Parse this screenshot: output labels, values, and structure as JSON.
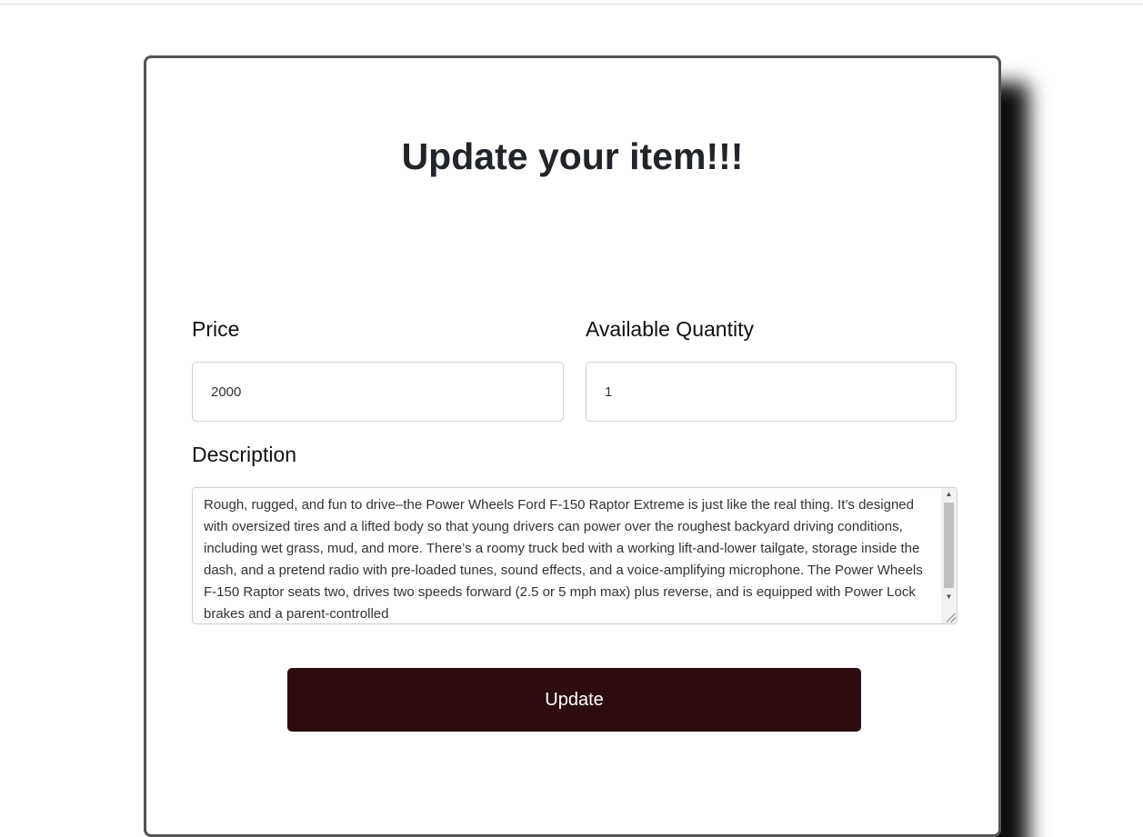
{
  "page": {
    "title": "Update your item!!!"
  },
  "form": {
    "price_label": "Price",
    "price_value": "2000",
    "quantity_label": "Available Quantity",
    "quantity_value": "1",
    "description_label": "Description",
    "description_value": "Rough, rugged, and fun to drive–the Power Wheels Ford F-150 Raptor Extreme is just like the real thing. It’s designed with oversized tires and a lifted body so that young drivers can power over the roughest backyard driving conditions, including wet grass, mud, and more. There’s a roomy truck bed with a working lift-and-lower tailgate, storage inside the dash, and a pretend radio with pre-loaded tunes, sound effects, and a voice-amplifying microphone. The Power Wheels F-150 Raptor seats two, drives two speeds forward (2.5 or 5 mph max) plus reverse, and is equipped with Power Lock brakes and a parent-controlled",
    "submit_label": "Update"
  },
  "colors": {
    "button_bg": "#2d0c10",
    "card_border": "#555555",
    "title_text": "#212529"
  },
  "icons": {
    "scroll_up": "scroll-up-arrow-icon",
    "scroll_down": "scroll-down-arrow-icon",
    "resize": "resize-grip-icon"
  }
}
